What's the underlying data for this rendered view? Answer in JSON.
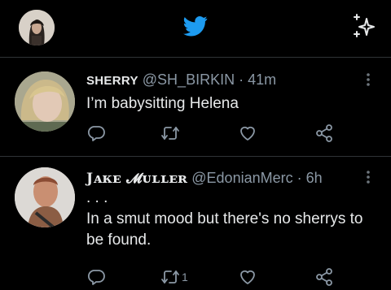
{
  "colors": {
    "background": "#000000",
    "accent": "#1d9bf0",
    "text": "#e7e9ea",
    "muted": "#8b98a5",
    "divider": "#2f3336"
  },
  "topbar": {
    "avatar_icon": "profile-avatar",
    "logo_icon": "twitter-bird-icon",
    "sparkle_icon": "sparkle-icon"
  },
  "tweets": [
    {
      "name": "SHERRY",
      "handle": "@SH_BIRKIN",
      "separator": "·",
      "time": "41m",
      "lines": [
        "I’m babysitting Helena"
      ],
      "retweet_count": "",
      "icons": [
        "reply-icon",
        "retweet-icon",
        "like-icon",
        "share-icon",
        "more-icon"
      ]
    },
    {
      "name": "Jᴀᴋᴇ 𝓜ᴜʟʟᴇʀ",
      "handle": "@EdonianMerc",
      "separator": "·",
      "time": "6h",
      "lines": [
        ". . .",
        "In a smut mood but there's no sherrys to",
        "be found."
      ],
      "retweet_count": "1",
      "icons": [
        "reply-icon",
        "retweet-icon",
        "like-icon",
        "share-icon",
        "more-icon"
      ]
    }
  ]
}
